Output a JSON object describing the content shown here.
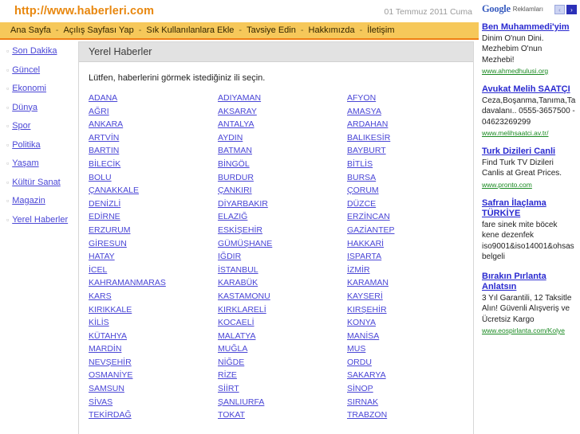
{
  "header": {
    "logo": "http://www.haberleri.com",
    "date": "01 Temmuz 2011 Cuma"
  },
  "nav": {
    "items": [
      {
        "label": "Ana Sayfa"
      },
      {
        "label": "Açılış Sayfası Yap"
      },
      {
        "label": "Sık Kullanılanlara Ekle"
      },
      {
        "label": "Tavsiye Edin"
      },
      {
        "label": "Hakkımızda"
      },
      {
        "label": "İletişim"
      }
    ],
    "separator": "-"
  },
  "sidebar": {
    "bullet": "▫",
    "items": [
      {
        "label": "Son Dakika"
      },
      {
        "label": "Güncel"
      },
      {
        "label": "Ekonomi"
      },
      {
        "label": "Dünya"
      },
      {
        "label": "Spor"
      },
      {
        "label": "Politika"
      },
      {
        "label": "Yaşam"
      },
      {
        "label": "Kültür Sanat"
      },
      {
        "label": "Magazin"
      },
      {
        "label": "Yerel Haberler"
      }
    ]
  },
  "main": {
    "panel_title": "Yerel Haberler",
    "intro": "Lütfen, haberlerini görmek istediğiniz ili seçin.",
    "city_columns": [
      [
        "ADANA",
        "AĞRI",
        "ANKARA",
        "ARTVİN",
        "BARTIN",
        "BİLECİK",
        "BOLU",
        "ÇANAKKALE",
        "DENİZLİ",
        "EDİRNE",
        "ERZURUM",
        "GİRESUN",
        "HATAY",
        "İCEL",
        "KAHRAMANMARAS",
        "KARS",
        "KIRIKKALE",
        "KİLİS",
        "KÜTAHYA",
        "MARDİN",
        "NEVŞEHİR",
        "OSMANİYE",
        "SAMSUN",
        "SİVAS",
        "TEKİRDAĞ"
      ],
      [
        "ADIYAMAN",
        "AKSARAY",
        "ANTALYA",
        "AYDIN",
        "BATMAN",
        "BİNGÖL",
        "BURDUR",
        "ÇANKIRI",
        "DİYARBAKIR",
        "ELAZIĞ",
        "ESKİŞEHİR",
        "GÜMÜŞHANE",
        "IĞDIR",
        "İSTANBUL",
        "KARABÜK",
        "KASTAMONU",
        "KIRKLARELİ",
        "KOCAELİ",
        "MALATYA",
        "MUĞLA",
        "NİĞDE",
        "RİZE",
        "SİİRT",
        "ŞANLIURFA",
        "TOKAT"
      ],
      [
        "AFYON",
        "AMASYA",
        "ARDAHAN",
        "BALIKESİR",
        "BAYBURT",
        "BİTLİS",
        "BURSA",
        "ÇORUM",
        "DÜZCE",
        "ERZİNCAN",
        "GAZİANTEP",
        "HAKKARİ",
        "ISPARTA",
        "İZMİR",
        "KARAMAN",
        "KAYSERİ",
        "KIRŞEHİR",
        "KONYA",
        "MANİSA",
        "MUS",
        "ORDU",
        "SAKARYA",
        "SİNOP",
        "SIRNAK",
        "TRABZON"
      ]
    ]
  },
  "ads": {
    "brand_google": "Google",
    "brand_label": "Reklamları",
    "prev_arrow": "‹",
    "next_arrow": "›",
    "items": [
      {
        "title": "Ben Muhammedi'yim",
        "lines": [
          "Dinim O'nun Dini.",
          "Mezhebim O'nun",
          "Mezhebi!"
        ],
        "url": "www.ahmedhulusi.org"
      },
      {
        "title": "Avukat Melih SAATÇI",
        "lines": [
          "Ceza,Boşanma,Tanıma,Ta",
          "davalanı.. 0555-3657500 -",
          "04623269299"
        ],
        "url": "www.melihsaatci.av.tr/"
      },
      {
        "title": "Turk Dizileri Canli",
        "lines": [
          "Find Turk TV Dizileri",
          "Canlis at Great Prices."
        ],
        "url": "www.pronto.com"
      },
      {
        "title": "Safran İlaçlama TÜRKİYE",
        "lines": [
          "fare sinek mite böcek",
          "kene dezenfek",
          "iso9001&iso14001&ohsas",
          "belgeli"
        ],
        "url": ""
      },
      {
        "title": "Bırakın Pırlanta Anlatsın",
        "lines": [
          "3 Yıl Garantili, 12 Taksitle",
          "Alın! Güvenli Alışveriş ve",
          "Ücretsiz Kargo"
        ],
        "url": "www.eospirlanta.com/Kolye"
      }
    ]
  },
  "colors": {
    "brand_orange": "#E8870E",
    "nav_gold": "#F6C85A",
    "nav_border": "#F07F13",
    "link_blue": "#4a46d6",
    "ad_link_blue": "#2a2ad0",
    "ad_url_green": "#1a8a22",
    "panel_header_gray": "#e2e2e2"
  }
}
